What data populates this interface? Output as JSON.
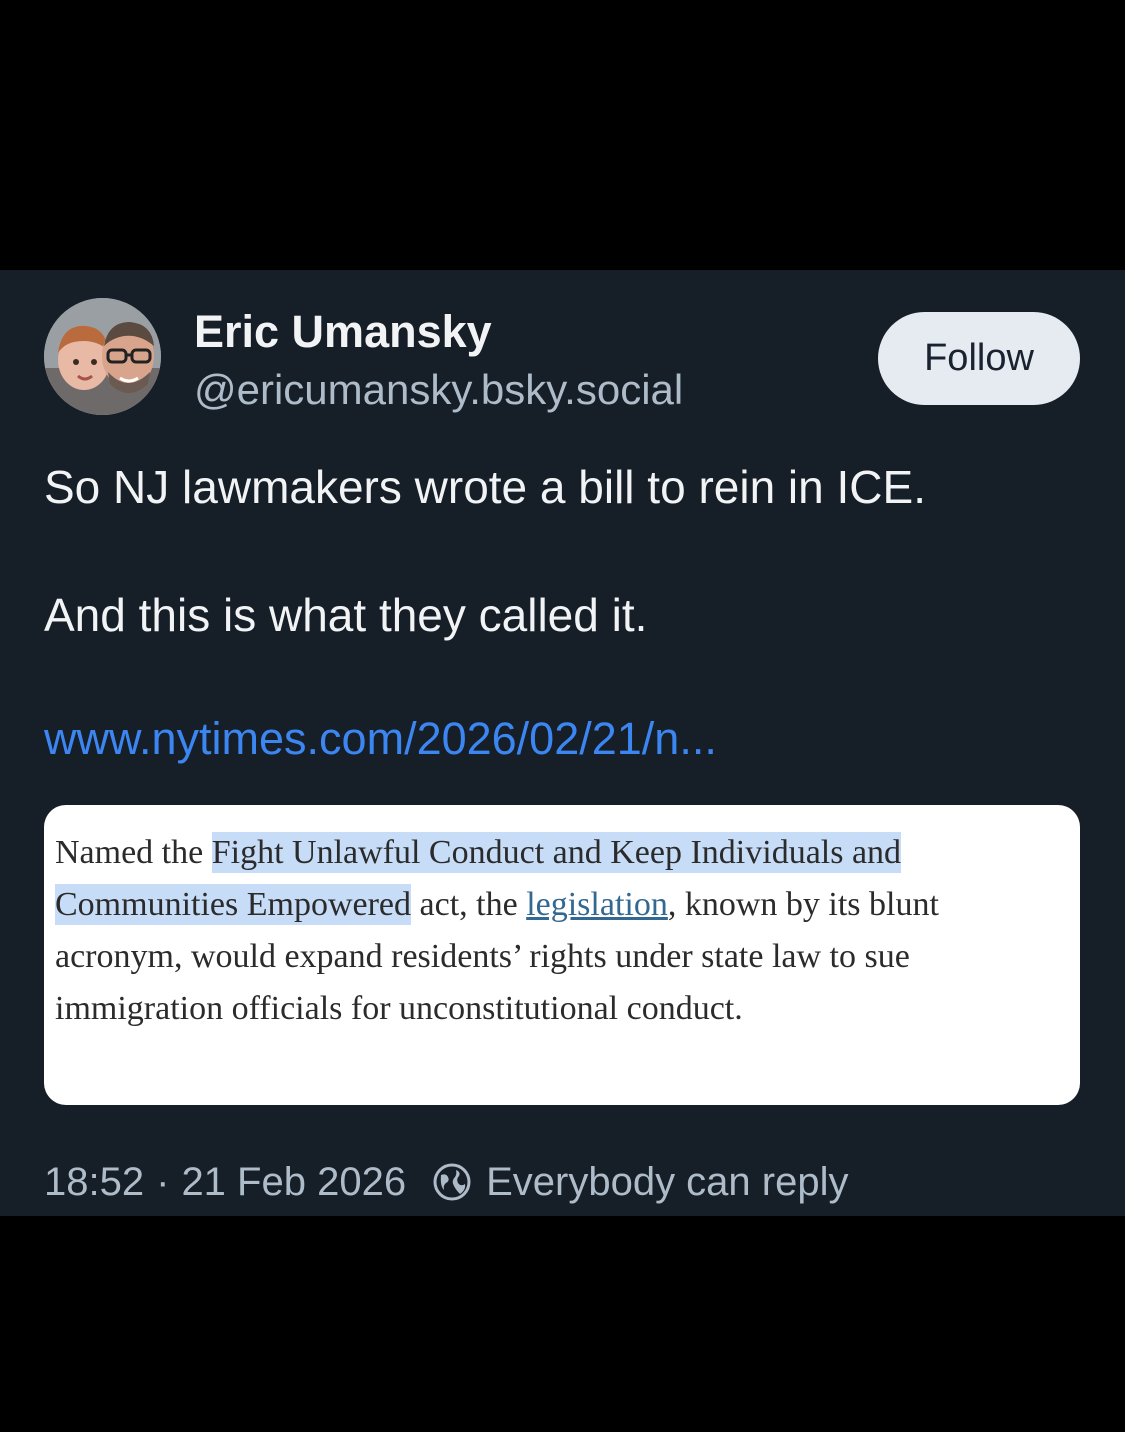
{
  "post": {
    "author_name": "Eric Umansky",
    "author_handle": "@ericumansky.bsky.social",
    "follow_label": "Follow",
    "text_line_1": "So NJ lawmakers wrote a bill to rein in ICE.",
    "text_line_2": "And this is what they called it.",
    "link_text": "www.nytimes.com/2026/02/21/n...",
    "quote": {
      "prefix": "Named the ",
      "highlight_1": "Fight Unlawful Conduct and Keep Individuals and",
      "highlight_2": "Communities Empowered",
      "middle": " act, the ",
      "link_word": "legislation",
      "rest_1": ", known by its blunt",
      "rest_2": "acronym, would expand residents’ rights under state law to sue",
      "rest_3": "immigration officials for unconstitutional conduct."
    },
    "time": "18:52",
    "separator": "·",
    "date": "21 Feb 2026",
    "reply_setting": "Everybody can reply"
  },
  "icons": {
    "avatar": "avatar-photo",
    "reply_setting": "globe-icon"
  },
  "colors": {
    "background": "#161e27",
    "accent_link": "#3c86f2",
    "highlight": "#c7dcf7"
  }
}
